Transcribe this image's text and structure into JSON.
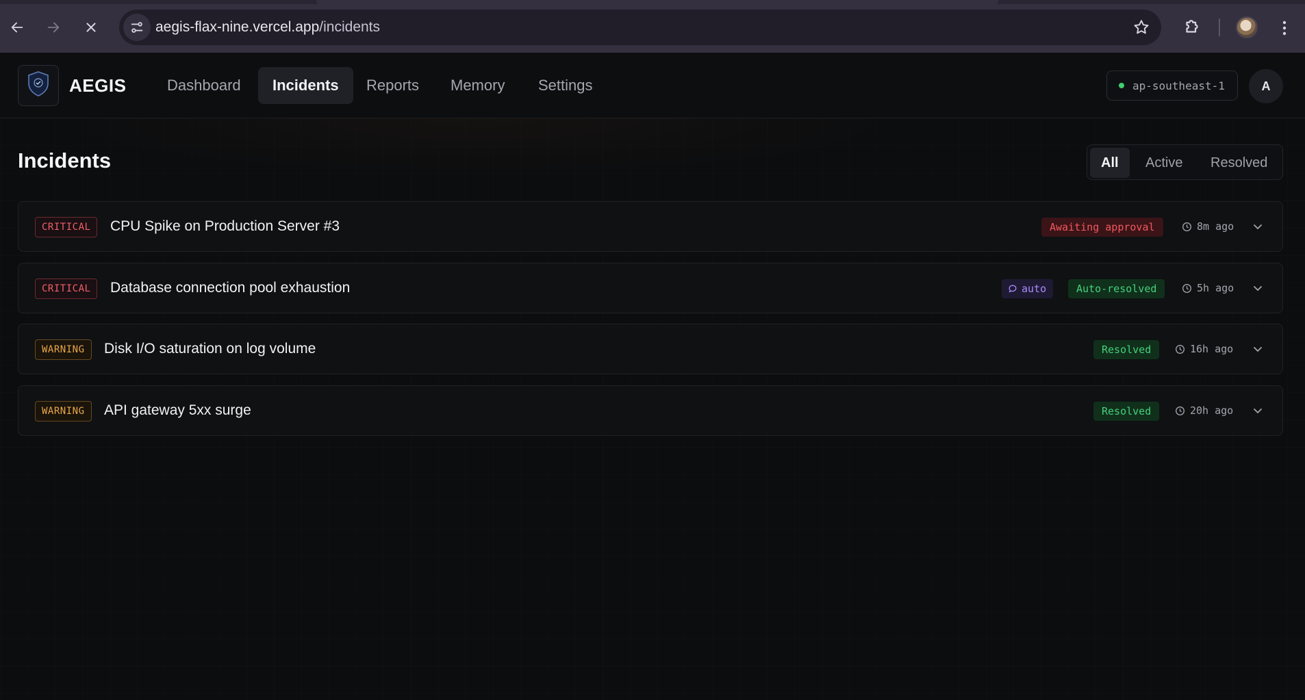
{
  "browser": {
    "url_host": "aegis-flax-nine.vercel.app",
    "url_path": "/incidents"
  },
  "app": {
    "brand": "AEGIS",
    "logo_text": "AEGIS",
    "nav": [
      {
        "label": "Dashboard"
      },
      {
        "label": "Incidents",
        "active": true
      },
      {
        "label": "Reports"
      },
      {
        "label": "Memory"
      },
      {
        "label": "Settings"
      }
    ],
    "region": "ap-southeast-1",
    "avatar_initial": "A"
  },
  "page": {
    "title": "Incidents",
    "filters": [
      {
        "label": "All",
        "active": true
      },
      {
        "label": "Active"
      },
      {
        "label": "Resolved"
      }
    ]
  },
  "incidents": [
    {
      "severity": "CRITICAL",
      "title": "CPU Spike on Production Server #3",
      "auto": null,
      "status": "Awaiting approval",
      "time": "8m ago"
    },
    {
      "severity": "CRITICAL",
      "title": "Database connection pool exhaustion",
      "auto": "auto",
      "status": "Auto-resolved",
      "time": "5h ago"
    },
    {
      "severity": "WARNING",
      "title": "Disk I/O saturation on log volume",
      "auto": null,
      "status": "Resolved",
      "time": "16h ago"
    },
    {
      "severity": "WARNING",
      "title": "API gateway 5xx surge",
      "auto": null,
      "status": "Resolved",
      "time": "20h ago"
    }
  ],
  "colors": {
    "critical": "#f0606a",
    "warning": "#e8a64a",
    "resolved": "#45d07a",
    "auto": "#a78bfa",
    "region_dot": "#3ecf6e"
  }
}
